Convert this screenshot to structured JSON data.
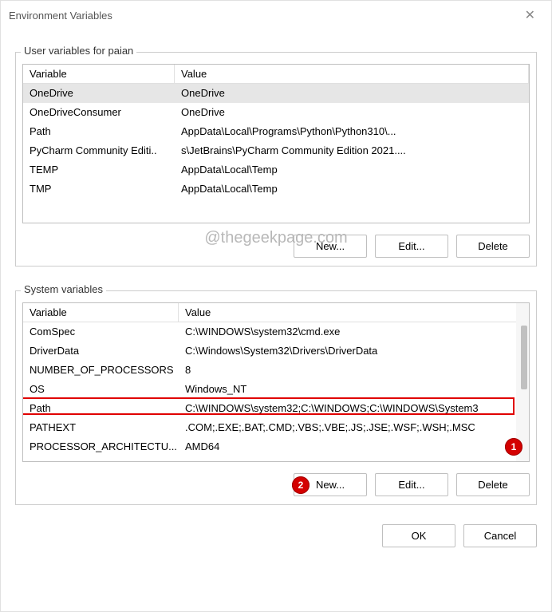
{
  "window": {
    "title": "Environment Variables"
  },
  "watermark": "@thegeekpage.com",
  "user_group": {
    "label": "User variables for paian",
    "header_variable": "Variable",
    "header_value": "Value",
    "rows": [
      {
        "name": "OneDrive",
        "value": "OneDrive",
        "selected": true
      },
      {
        "name": "OneDriveConsumer",
        "value": "OneDrive",
        "selected": false
      },
      {
        "name": "Path",
        "value": "AppData\\Local\\Programs\\Python\\Python310\\...",
        "selected": false
      },
      {
        "name": "PyCharm Community Editi..",
        "value": "s\\JetBrains\\PyCharm Community Edition 2021....",
        "selected": false
      },
      {
        "name": "TEMP",
        "value": "AppData\\Local\\Temp",
        "selected": false
      },
      {
        "name": "TMP",
        "value": "AppData\\Local\\Temp",
        "selected": false
      }
    ],
    "buttons": {
      "new": "New...",
      "edit": "Edit...",
      "delete": "Delete"
    }
  },
  "system_group": {
    "label": "System variables",
    "header_variable": "Variable",
    "header_value": "Value",
    "rows": [
      {
        "name": "ComSpec",
        "value": "C:\\WINDOWS\\system32\\cmd.exe",
        "selected": false
      },
      {
        "name": "DriverData",
        "value": "C:\\Windows\\System32\\Drivers\\DriverData",
        "selected": false
      },
      {
        "name": "NUMBER_OF_PROCESSORS",
        "value": "8",
        "selected": false
      },
      {
        "name": "OS",
        "value": "Windows_NT",
        "selected": false
      },
      {
        "name": "Path",
        "value": "C:\\WINDOWS\\system32;C:\\WINDOWS;C:\\WINDOWS\\System3",
        "selected": false
      },
      {
        "name": "PATHEXT",
        "value": ".COM;.EXE;.BAT;.CMD;.VBS;.VBE;.JS;.JSE;.WSF;.WSH;.MSC",
        "selected": false
      },
      {
        "name": "PROCESSOR_ARCHITECTU...",
        "value": "AMD64",
        "selected": false
      }
    ],
    "buttons": {
      "new": "New...",
      "edit": "Edit...",
      "delete": "Delete"
    }
  },
  "dialog_buttons": {
    "ok": "OK",
    "cancel": "Cancel"
  },
  "callouts": {
    "one": "1",
    "two": "2"
  }
}
